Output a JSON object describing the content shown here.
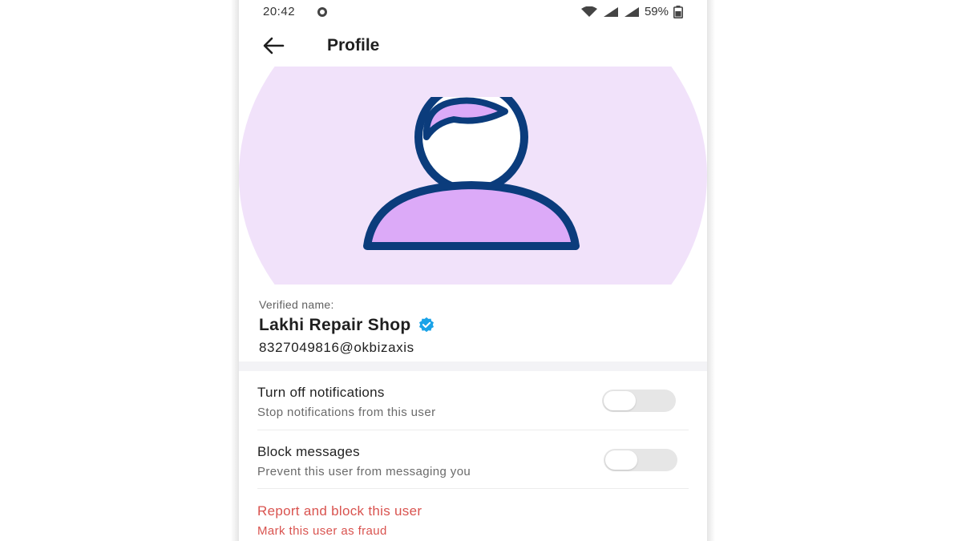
{
  "status_bar": {
    "time": "20:42",
    "battery": "59%",
    "icons": [
      "settings-dot-icon",
      "wifi-icon",
      "signal-icon",
      "signal-icon",
      "battery-icon"
    ]
  },
  "app_bar": {
    "title": "Profile",
    "back_icon": "arrow-left-icon"
  },
  "profile": {
    "verified_caption": "Verified name:",
    "name": "Lakhi Repair Shop",
    "upi_id": "8327049816@okbizaxis",
    "badge_icon": "verified-badge-icon",
    "avatar_icon": "person-avatar-icon"
  },
  "settings": [
    {
      "title": "Turn off notifications",
      "subtitle": "Stop notifications from this user",
      "enabled": false
    },
    {
      "title": "Block messages",
      "subtitle": "Prevent this user from messaging you",
      "enabled": false
    }
  ],
  "danger": {
    "title": "Report and block this user",
    "subtitle": "Mark this user as fraud"
  },
  "colors": {
    "hero_bg": "#f1e2fa",
    "avatar_stroke": "#0b3c7c",
    "avatar_fill": "#dcaaf8",
    "verified_badge": "#1aa3e8",
    "danger": "#d9534f",
    "toggle_off": "#e6e6e6"
  }
}
